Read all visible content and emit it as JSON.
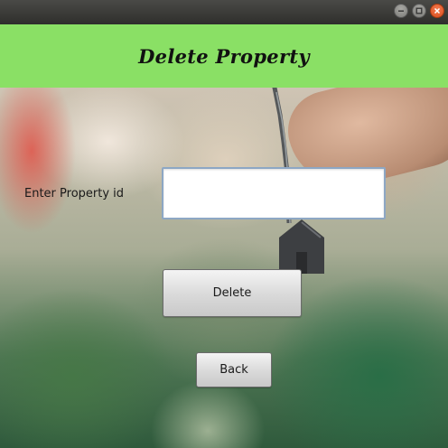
{
  "window": {
    "controls": [
      {
        "icon": "minimize-icon"
      },
      {
        "icon": "maximize-icon"
      },
      {
        "icon": "close-icon"
      }
    ]
  },
  "header": {
    "title": "Delete Property",
    "background_color": "#8ae065"
  },
  "form": {
    "property_id_label": "Enter Property id",
    "property_id_value": "",
    "delete_button_label": "Delete",
    "back_button_label": "Back"
  }
}
